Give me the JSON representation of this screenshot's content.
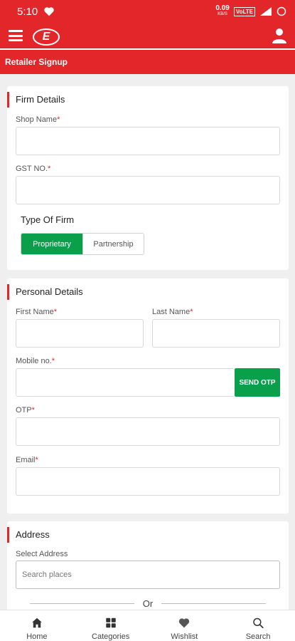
{
  "status_bar": {
    "time": "5:10",
    "speed": "0.09",
    "speed_unit": "KB/S",
    "network": "VoLTE"
  },
  "sub_header": {
    "title": "Retailer Signup"
  },
  "logo": {
    "text": "E"
  },
  "firm": {
    "title": "Firm Details",
    "shop_name_label": "Shop Name",
    "gst_label": "GST NO.",
    "type_label": "Type Of Firm",
    "type_options": [
      "Proprietary",
      "Partnership"
    ],
    "type_selected": "Proprietary"
  },
  "personal": {
    "title": "Personal Details",
    "first_name_label": "First Name",
    "last_name_label": "Last Name",
    "mobile_label": "Mobile no.",
    "send_otp": "SEND OTP",
    "otp_label": "OTP",
    "email_label": "Email"
  },
  "address": {
    "title": "Address",
    "select_label": "Select Address",
    "search_placeholder": "Search places",
    "or_text": "Or"
  },
  "required_marker": "*",
  "nav": {
    "items": [
      {
        "label": "Home",
        "icon": "home-icon"
      },
      {
        "label": "Categories",
        "icon": "grid-icon"
      },
      {
        "label": "Wishlist",
        "icon": "heart-icon"
      },
      {
        "label": "Search",
        "icon": "search-icon"
      }
    ]
  },
  "colors": {
    "brand_red": "#e3262a",
    "accent_green": "#0aa04b"
  }
}
